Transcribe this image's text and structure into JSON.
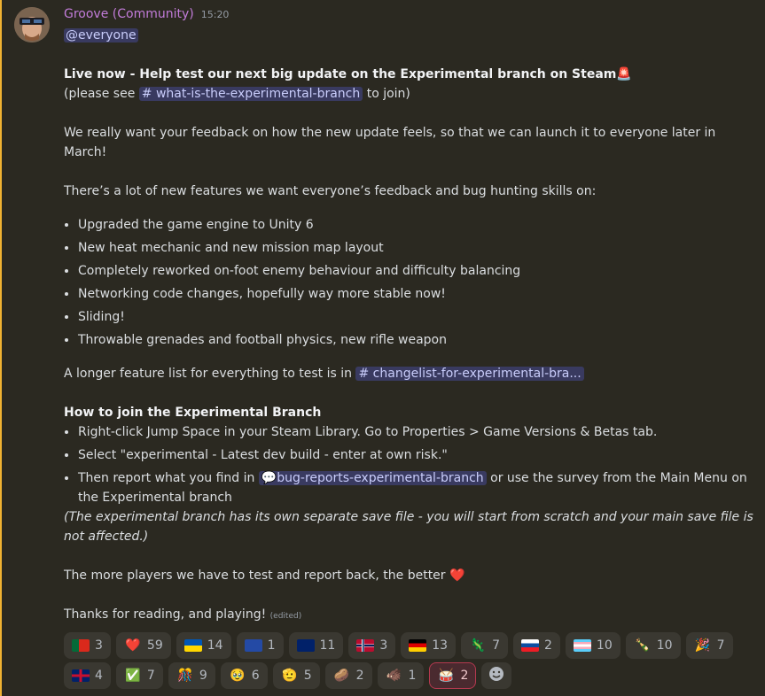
{
  "author": {
    "name": "Groove (Community)",
    "time": "15:20"
  },
  "mention": "@everyone",
  "title": "Live now - Help test our next big update on the Experimental branch on Steam",
  "title_emoji": "🚨",
  "see_prefix": "(please see ",
  "see_channel": "# what-is-the-experimental-branch",
  "see_suffix": " to join)",
  "para1": "We really want your feedback on how the new update feels, so that we can launch it to everyone later in March!",
  "para2": "There’s a lot of new features we want everyone’s feedback and bug hunting skills on:",
  "features": [
    "Upgraded the game engine to Unity 6",
    "New heat mechanic and new mission map layout",
    "Completely reworked on-foot enemy behaviour and difficulty balancing",
    "Networking code changes, hopefully way more stable now!",
    "Sliding!",
    "Throwable grenades and football physics, new rifle weapon"
  ],
  "longer_prefix": "A longer feature list for everything to test is in ",
  "longer_channel": "# changelist-for-experimental-bra...",
  "howto_title": "How to join the Experimental Branch",
  "howto": {
    "step1": "Right-click Jump Space in your Steam Library. Go to Properties > Game Versions & Betas tab.",
    "step2": "Select \"experimental - Latest dev build - enter at own risk.\"",
    "step3_prefix": "Then report what you find in ",
    "step3_channel": "bug-reports-experimental-branch",
    "step3_suffix": " or use the survey from the Main Menu on the Experimental branch"
  },
  "note": "(The experimental branch has its own separate save file - you will start from scratch and your main save file is not affected.)",
  "players_line": "The more players we have to test and report back, the better",
  "players_emoji": "❤️",
  "thanks": "Thanks for reading, and playing!",
  "edited": "(edited)",
  "reactions": [
    {
      "emoji": "portugal-flag",
      "count": "3"
    },
    {
      "emoji": "❤️",
      "count": "59"
    },
    {
      "emoji": "ukraine-flag",
      "count": "14"
    },
    {
      "emoji": "kosovo-flag",
      "count": "1"
    },
    {
      "emoji": "australia-flag",
      "count": "11"
    },
    {
      "emoji": "norway-flag",
      "count": "3"
    },
    {
      "emoji": "germany-flag",
      "count": "13"
    },
    {
      "emoji": "🦎",
      "count": "7"
    },
    {
      "emoji": "slovakia-flag",
      "count": "2"
    },
    {
      "emoji": "transgender-flag",
      "count": "10"
    },
    {
      "emoji": "🍾",
      "count": "10"
    },
    {
      "emoji": "🎉",
      "count": "7"
    },
    {
      "emoji": "uk-flag",
      "count": "4"
    },
    {
      "emoji": "✅",
      "count": "7"
    },
    {
      "emoji": "🎊",
      "count": "9"
    },
    {
      "emoji": "🥹",
      "count": "6"
    },
    {
      "emoji": "🫡",
      "count": "5"
    },
    {
      "emoji": "🥔",
      "count": "2"
    },
    {
      "emoji": "🐗",
      "count": "1"
    },
    {
      "emoji": "🥁",
      "count": "2"
    }
  ],
  "colors": {
    "author": "#c27cd9",
    "mention_bar": "#f0b232",
    "heart": "#f23f43"
  }
}
